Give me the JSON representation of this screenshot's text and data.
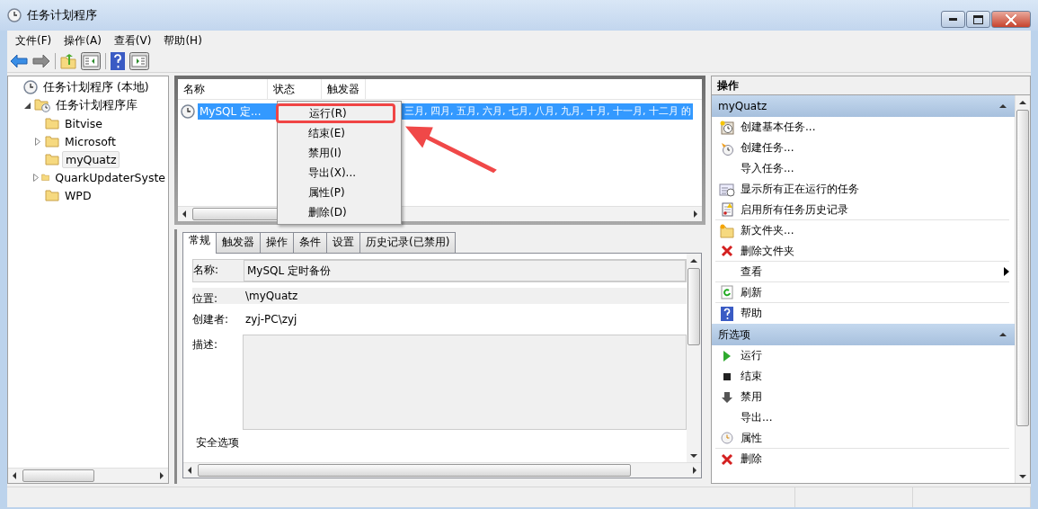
{
  "window": {
    "title": "任务计划程序"
  },
  "menu": [
    "文件(F)",
    "操作(A)",
    "查看(V)",
    "帮助(H)"
  ],
  "toolbar": [
    {
      "kind": "back"
    },
    {
      "kind": "forward"
    },
    {
      "kind": "up"
    },
    {
      "kind": "show-tree"
    },
    {
      "kind": "help"
    },
    {
      "kind": "show-actions"
    }
  ],
  "tree": [
    {
      "label": "任务计划程序 (本地)",
      "kind": "computer",
      "selected": false,
      "children": [
        {
          "label": "任务计划程序库",
          "kind": "library",
          "expanded": true,
          "selected": false,
          "children": [
            {
              "label": "Bitvise",
              "kind": "folder",
              "selected": false
            },
            {
              "label": "Microsoft",
              "kind": "folder",
              "expanded": false,
              "selected": false
            },
            {
              "label": "myQuatz",
              "kind": "folder",
              "selected": true
            },
            {
              "label": "QuarkUpdaterSyste",
              "kind": "folder",
              "expanded": false,
              "selected": false
            },
            {
              "label": "WPD",
              "kind": "folder",
              "selected": false
            }
          ]
        }
      ]
    }
  ],
  "task_list": {
    "columns": [
      "名称",
      "状态",
      "触发器"
    ],
    "rows": [
      {
        "name": "MySQL 定...",
        "trigger": "三月, 四月, 五月, 六月, 七月, 八月, 九月, 十月, 十一月, 十二月 的",
        "selected": true
      }
    ]
  },
  "context_menu": [
    {
      "label": "运行(R)",
      "highlighted": true
    },
    {
      "label": "结束(E)",
      "highlighted": false
    },
    {
      "label": "禁用(I)",
      "highlighted": false
    },
    {
      "label": "导出(X)...",
      "highlighted": false
    },
    {
      "label": "属性(P)",
      "highlighted": false
    },
    {
      "label": "删除(D)",
      "highlighted": false
    }
  ],
  "details": {
    "tabs": [
      {
        "label": "常规",
        "selected": true
      },
      {
        "label": "触发器",
        "selected": false
      },
      {
        "label": "操作",
        "selected": false
      },
      {
        "label": "条件",
        "selected": false
      },
      {
        "label": "设置",
        "selected": false
      },
      {
        "label": "历史记录(已禁用)",
        "selected": false
      }
    ],
    "fields": [
      {
        "label": "名称:",
        "value": "MySQL 定时备份",
        "kind": "box"
      },
      {
        "label": "位置:",
        "value": "\\myQuatz",
        "kind": "band"
      },
      {
        "label": "创建者:",
        "value": "zyj-PC\\zyj",
        "kind": "plain"
      },
      {
        "label": "描述:",
        "kind": "textarea"
      }
    ],
    "group_label": "安全选项"
  },
  "actions": {
    "title": "操作",
    "sections": [
      {
        "title": "myQuatz",
        "expanded": true,
        "items": [
          {
            "label": "创建基本任务...",
            "kind": "basic-task",
            "submenu": false,
            "divider_after": false
          },
          {
            "label": "创建任务...",
            "kind": "new-task",
            "submenu": false,
            "divider_after": false
          },
          {
            "label": "导入任务...",
            "kind": "plain",
            "submenu": false,
            "divider_after": false
          },
          {
            "label": "显示所有正在运行的任务",
            "kind": "running",
            "submenu": false,
            "divider_after": false
          },
          {
            "label": "启用所有任务历史记录",
            "kind": "history",
            "submenu": false,
            "divider_after": true
          },
          {
            "label": "新文件夹...",
            "kind": "new-folder",
            "submenu": false,
            "divider_after": false
          },
          {
            "label": "删除文件夹",
            "kind": "delete",
            "submenu": false,
            "divider_after": true
          },
          {
            "label": "查看",
            "kind": "plain",
            "submenu": true,
            "divider_after": true
          },
          {
            "label": "刷新",
            "kind": "refresh",
            "submenu": false,
            "divider_after": true
          },
          {
            "label": "帮助",
            "kind": "help",
            "submenu": false,
            "divider_after": false
          }
        ]
      },
      {
        "title": "所选项",
        "expanded": true,
        "items": [
          {
            "label": "运行",
            "kind": "run",
            "submenu": false,
            "divider_after": false
          },
          {
            "label": "结束",
            "kind": "stop",
            "submenu": false,
            "divider_after": false
          },
          {
            "label": "禁用",
            "kind": "disable",
            "submenu": false,
            "divider_after": false
          },
          {
            "label": "导出...",
            "kind": "plain",
            "submenu": false,
            "divider_after": false
          },
          {
            "label": "属性",
            "kind": "properties",
            "submenu": false,
            "divider_after": true
          },
          {
            "label": "删除",
            "kind": "delete",
            "submenu": false,
            "divider_after": false
          }
        ]
      }
    ]
  }
}
